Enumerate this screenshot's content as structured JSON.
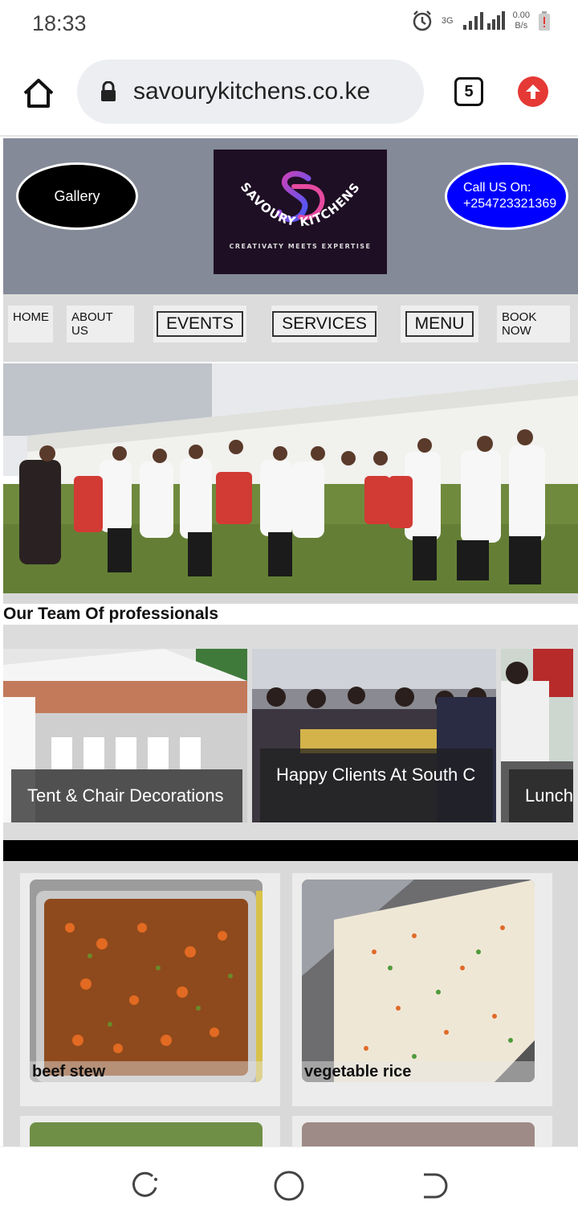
{
  "status_bar": {
    "time": "18:33",
    "network": "3G",
    "speed_value": "0.00",
    "speed_unit": "B/s"
  },
  "browser": {
    "url": "savourykitchens.co.ke",
    "tab_count": "5"
  },
  "header": {
    "gallery_label": "Gallery",
    "call_line1": "Call US On:",
    "call_line2": "+254723321369",
    "logo_text": "SAVOURY KITCHENS",
    "logo_tagline": "CREATIVATY MEETS EXPERTISE"
  },
  "nav": {
    "home": "HOME",
    "about": "ABOUT US",
    "events": "EVENTS",
    "services": "SERVICES",
    "menu": "MENU",
    "book": "BOOK NOW"
  },
  "hero": {
    "caption": "Our Team Of professionals"
  },
  "carousel": {
    "slides": [
      "Tent & Chair Decorations",
      "Happy Clients At South C",
      "Lunch"
    ]
  },
  "menu_items": [
    "beef stew",
    "vegetable rice"
  ],
  "colors": {
    "header_bg": "#848a98",
    "call_button": "#0000ff",
    "gallery_button": "#000000",
    "update_badge": "#e53935"
  }
}
